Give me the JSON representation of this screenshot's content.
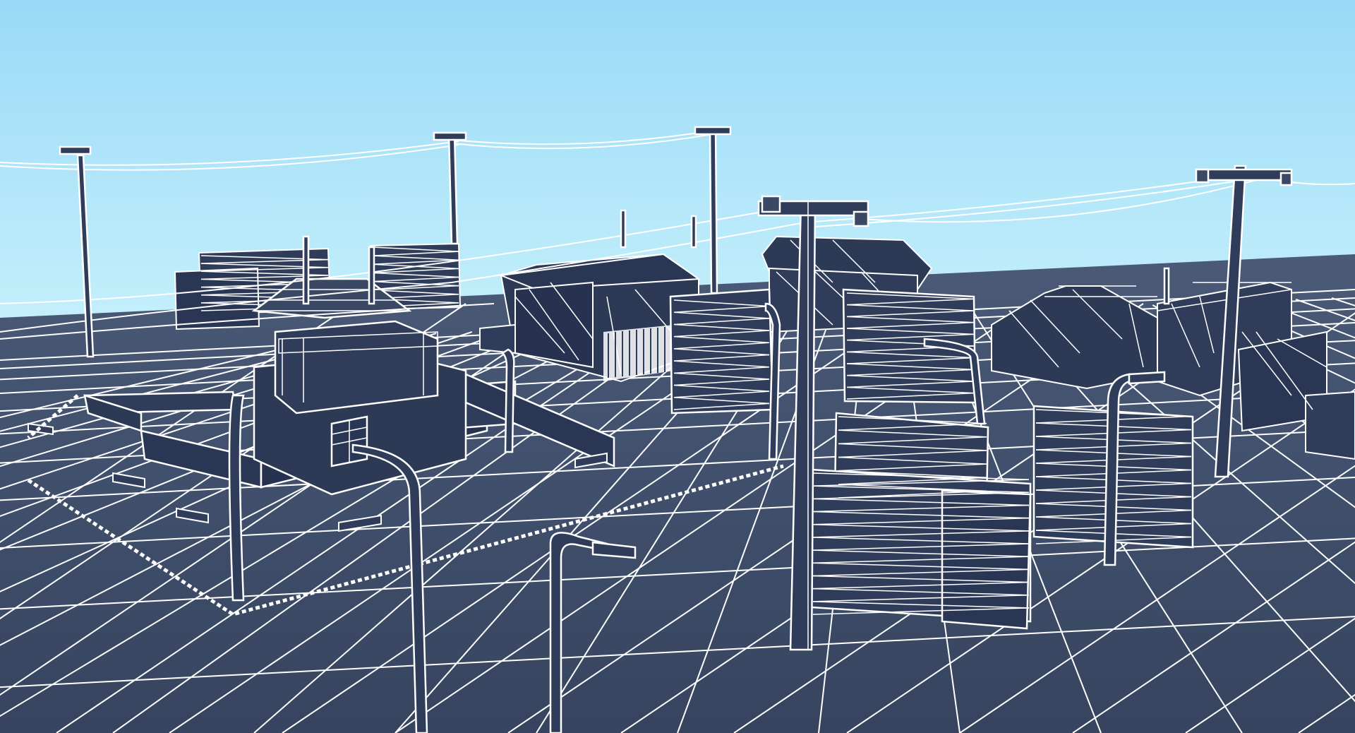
{
  "scene": {
    "kind": "3d-wireframe-town-viewport",
    "colors": {
      "sky_top": "#9ad9f7",
      "sky_bottom": "#c4f0fb",
      "ground": "#3b4a66",
      "ground_far": "#4a5a77",
      "mesh_fill": "#2f3d5a",
      "mesh_fill_dark": "#253251",
      "wire": "#ffffff"
    },
    "objects": [
      "ground-grid",
      "power-lines",
      "utility-pole-far-left",
      "utility-pole-center-left",
      "utility-pole-center",
      "utility-pole-front",
      "utility-pole-right",
      "billboard-panels-far-left",
      "house-with-courtyard",
      "courtyard-wall",
      "benches",
      "warehouse-center",
      "house-right-back",
      "ruined-houses-right",
      "billboard-stack-center-right",
      "street-lamps"
    ]
  }
}
